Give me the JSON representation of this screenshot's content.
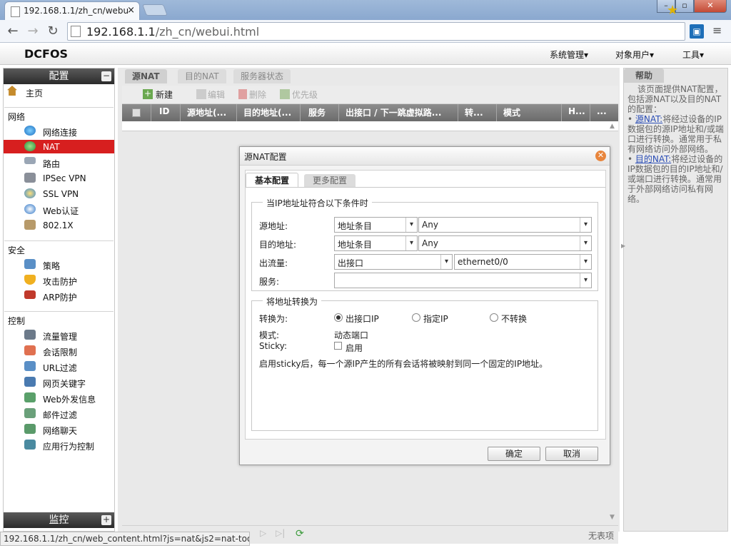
{
  "browser": {
    "tab_title": "192.168.1.1/zh_cn/webu",
    "tab_close": "×",
    "url_host": "192.168.1.1",
    "url_path": "/zh_cn/webui.html",
    "status_url": "192.168.1.1/zh_cn/web_content.html?js=nat&js2=nat-tools#"
  },
  "app": {
    "logo": "DCFOS",
    "top_menu": [
      "系统管理▾",
      "对象用户▾",
      "工具▾"
    ]
  },
  "sidebar": {
    "header": "配置",
    "header_btn": "−",
    "home": "主页",
    "sections": [
      {
        "title": "网络",
        "items": [
          "网络连接",
          "NAT",
          "路由",
          "IPSec VPN",
          "SSL VPN",
          "Web认证",
          "802.1X"
        ]
      },
      {
        "title": "安全",
        "items": [
          "策略",
          "攻击防护",
          "ARP防护"
        ]
      },
      {
        "title": "控制",
        "items": [
          "流量管理",
          "会话限制",
          "URL过滤",
          "网页关键字",
          "Web外发信息",
          "邮件过滤",
          "网络聊天",
          "应用行为控制"
        ]
      }
    ],
    "footer": "监控",
    "footer_btn": "+",
    "active_item": "NAT",
    "accent": "#d71f1f"
  },
  "content": {
    "tabs": [
      "源NAT",
      "目的NAT",
      "服务器状态"
    ],
    "toolbar": {
      "new": "新建",
      "edit": "编辑",
      "delete": "删除",
      "priority": "优先级"
    },
    "columns": [
      "ID",
      "源地址(...",
      "目的地址(...",
      "服务",
      "出接口 / 下一跳虚拟路...",
      "转...",
      "模式",
      "H...",
      "..."
    ],
    "pager_info": "无表项"
  },
  "help": {
    "title": "帮助",
    "intro": "该页面提供NAT配置，包括源NAT以及目的NAT的配置：",
    "items": [
      {
        "link": "源NAT:",
        "text": "将经过设备的IP数据包的源IP地址和/或端口进行转换。通常用于私有网络访问外部网络。"
      },
      {
        "link": "目的NAT:",
        "text": "将经过设备的IP数据包的目的IP地址和/或端口进行转换。通常用于外部网络访问私有网络。"
      }
    ]
  },
  "dialog": {
    "title": "源NAT配置",
    "tabs": [
      "基本配置",
      "更多配置"
    ],
    "section1": "当IP地址址符合以下条件时",
    "fields": {
      "src_label": "源地址:",
      "src_type": "地址条目",
      "src_value": "Any",
      "dst_label": "目的地址:",
      "dst_type": "地址条目",
      "dst_value": "Any",
      "egress_label": "出流量:",
      "egress_type": "出接口",
      "egress_value": "ethernet0/0",
      "service_label": "服务:",
      "service_value": ""
    },
    "section2": "将地址转换为",
    "translate_label": "转换为:",
    "radios": [
      "出接口IP",
      "指定IP",
      "不转换"
    ],
    "selected_radio": "出接口IP",
    "mode_label": "模式:",
    "mode_value": "动态端口",
    "sticky_label": "Sticky:",
    "sticky_check": "启用",
    "sticky_note": "启用sticky后，每一个源IP产生的所有会话将被映射到同一个固定的IP地址。",
    "ok": "确定",
    "cancel": "取消"
  }
}
